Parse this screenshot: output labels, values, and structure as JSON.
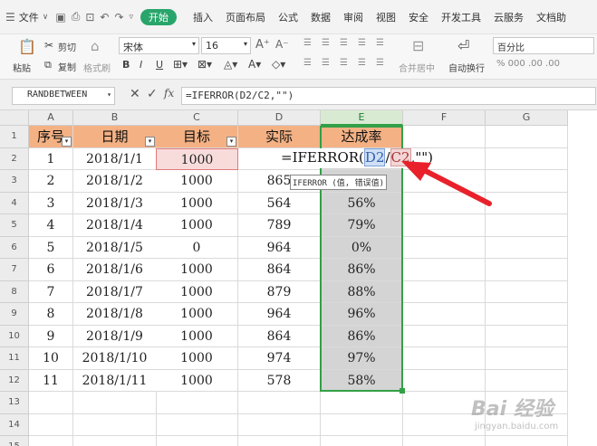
{
  "menu": {
    "file": "文件",
    "start": "开始",
    "tabs": [
      "插入",
      "页面布局",
      "公式",
      "数据",
      "审阅",
      "视图",
      "安全",
      "开发工具",
      "云服务",
      "文档助"
    ]
  },
  "ribbon": {
    "paste": "粘贴",
    "cut": "剪切",
    "copy": "复制",
    "format_painter": "格式刷",
    "font_name": "宋体",
    "font_size": "16",
    "merge_center": "合并居中",
    "wrap_text": "自动换行",
    "number_format": "百分比",
    "number_buttons": "% 000 .00 .00"
  },
  "formula_bar": {
    "name_box": "RANDBETWEEN",
    "fx": "fx",
    "formula": "=IFERROR(D2/C2,\"\")"
  },
  "grid": {
    "col_headers": [
      "A",
      "B",
      "C",
      "D",
      "E",
      "F",
      "G"
    ],
    "row_headers": [
      "1",
      "2",
      "3",
      "4",
      "5",
      "6",
      "7",
      "8",
      "9",
      "10",
      "11",
      "12",
      "13",
      "14",
      "15"
    ],
    "headers": [
      "序号",
      "日期",
      "目标",
      "实际",
      "达成率"
    ],
    "rows": [
      [
        "1",
        "2018/1/1",
        "1000",
        "",
        ""
      ],
      [
        "2",
        "2018/1/2",
        "1000",
        "865",
        ""
      ],
      [
        "3",
        "2018/1/3",
        "1000",
        "564",
        "56%"
      ],
      [
        "4",
        "2018/1/4",
        "1000",
        "789",
        "79%"
      ],
      [
        "5",
        "2018/1/5",
        "0",
        "964",
        "0%"
      ],
      [
        "6",
        "2018/1/6",
        "1000",
        "864",
        "86%"
      ],
      [
        "7",
        "2018/1/7",
        "1000",
        "879",
        "88%"
      ],
      [
        "8",
        "2018/1/8",
        "1000",
        "964",
        "96%"
      ],
      [
        "9",
        "2018/1/9",
        "1000",
        "864",
        "86%"
      ],
      [
        "10",
        "2018/1/10",
        "1000",
        "974",
        "97%"
      ],
      [
        "11",
        "2018/1/11",
        "1000",
        "578",
        "58%"
      ]
    ],
    "edit_prefix": "=IFERROR(",
    "edit_ref1": "D2",
    "edit_sep": "/",
    "edit_ref2": "C2",
    "edit_suffix": ",\"\")",
    "tooltip": "IFERROR (值, 错误值)"
  },
  "watermark": {
    "brand": "Bai 经验",
    "url": "jingyan.baidu.com"
  },
  "colors": {
    "header_fill": "#f4b184",
    "selection": "#33a047",
    "arrow": "#e8212b"
  }
}
